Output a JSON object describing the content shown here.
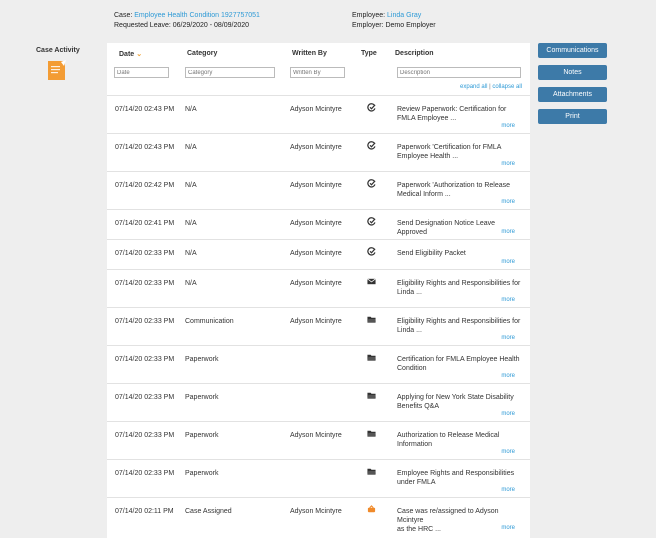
{
  "header": {
    "case_label": "Case:",
    "case_value": "Employee Health Condition 1927757051",
    "requested_leave": "Requested Leave: 06/29/2020 - 08/09/2020",
    "employee_label": "Employee:",
    "employee_value": "Linda Gray",
    "employer": "Employer: Demo Employer"
  },
  "sidebar": {
    "title": "Case Activity"
  },
  "table": {
    "columns": [
      "Date",
      "Category",
      "Written By",
      "Type",
      "Description"
    ],
    "filters": {
      "date": "Date",
      "category": "Category",
      "written_by": "Written By",
      "description": "Description"
    },
    "expand_all": "expand all",
    "separator": "|",
    "collapse_all": "collapse all",
    "more_label": "more",
    "rows": [
      {
        "date": "07/14/20 02:43 PM",
        "category": "N/A",
        "written_by": "Adyson Mcintyre",
        "type_icon": "check-icon",
        "desc1": "Review Paperwork: Certification for",
        "desc2": "FMLA Employee ..."
      },
      {
        "date": "07/14/20 02:43 PM",
        "category": "N/A",
        "written_by": "Adyson Mcintyre",
        "type_icon": "check-icon",
        "desc1": "Paperwork 'Certification for FMLA",
        "desc2": "Employee Health ..."
      },
      {
        "date": "07/14/20 02:42 PM",
        "category": "N/A",
        "written_by": "Adyson Mcintyre",
        "type_icon": "check-icon",
        "desc1": "Paperwork 'Authorization to Release",
        "desc2": "Medical Inform ..."
      },
      {
        "date": "07/14/20 02:41 PM",
        "category": "N/A",
        "written_by": "Adyson Mcintyre",
        "type_icon": "check-icon",
        "desc1": "Send Designation Notice Leave Approved",
        "desc2": ""
      },
      {
        "date": "07/14/20 02:33 PM",
        "category": "N/A",
        "written_by": "Adyson Mcintyre",
        "type_icon": "check-icon",
        "desc1": "Send Eligibility Packet",
        "desc2": ""
      },
      {
        "date": "07/14/20 02:33 PM",
        "category": "N/A",
        "written_by": "Adyson Mcintyre",
        "type_icon": "envelope-icon",
        "desc1": "Eligibility Rights and Responsibilities for",
        "desc2": "Linda ..."
      },
      {
        "date": "07/14/20 02:33 PM",
        "category": "Communication",
        "written_by": "Adyson Mcintyre",
        "type_icon": "folder-icon",
        "desc1": "Eligibility Rights and Responsibilities for",
        "desc2": "Linda ..."
      },
      {
        "date": "07/14/20 02:33 PM",
        "category": "Paperwork",
        "written_by": "",
        "type_icon": "folder-icon",
        "desc1": "Certification for FMLA Employee Health",
        "desc2": "Condition"
      },
      {
        "date": "07/14/20 02:33 PM",
        "category": "Paperwork",
        "written_by": "",
        "type_icon": "folder-icon",
        "desc1": "Applying for New York State Disability",
        "desc2": "Benefits Q&A"
      },
      {
        "date": "07/14/20 02:33 PM",
        "category": "Paperwork",
        "written_by": "Adyson Mcintyre",
        "type_icon": "folder-icon",
        "desc1": "Authorization to Release Medical",
        "desc2": "Information"
      },
      {
        "date": "07/14/20 02:33 PM",
        "category": "Paperwork",
        "written_by": "",
        "type_icon": "folder-icon",
        "desc1": "Employee Rights and Responsibilities",
        "desc2": "under FMLA"
      },
      {
        "date": "07/14/20 02:11 PM",
        "category": "Case Assigned",
        "written_by": "Adyson Mcintyre",
        "type_icon": "reassign-icon",
        "desc1": "Case was re/assigned to Adyson Mcintyre",
        "desc2": "as the HRC ..."
      }
    ]
  },
  "buttons": [
    "Communications",
    "Notes",
    "Attachments",
    "Print"
  ],
  "colors": {
    "accent": "#2e9ad6",
    "button": "#3d7aa8",
    "sort_arrow": "#f0a030",
    "reassign_icon": "#f08a2a",
    "case_icon": "#f39c34"
  }
}
